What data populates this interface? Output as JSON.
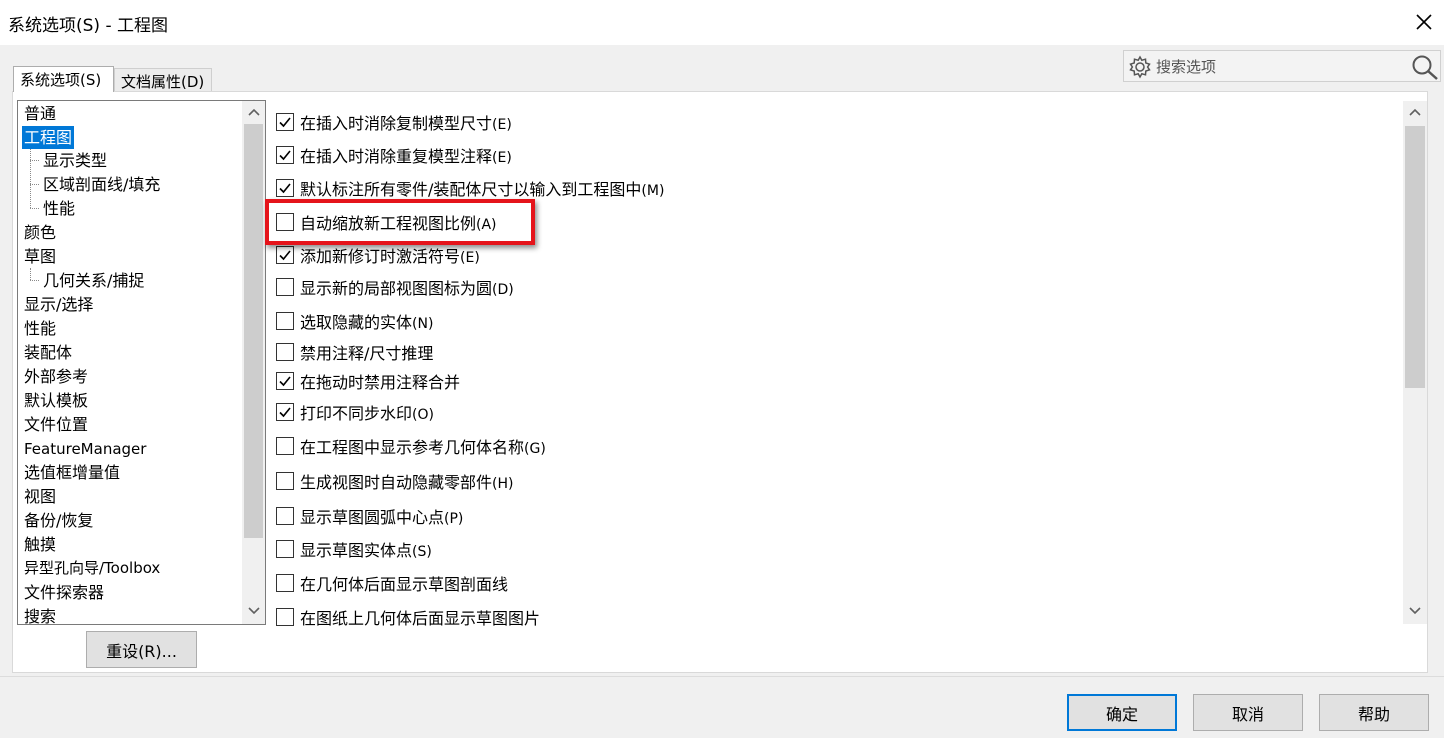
{
  "window": {
    "title": "系统选项(S) - 工程图",
    "close_icon": "close-icon"
  },
  "search": {
    "placeholder": "搜索选项",
    "gear_icon": "gear-icon",
    "search_icon": "search-icon"
  },
  "tabs": [
    {
      "label": "系统选项(S)",
      "active": true
    },
    {
      "label": "文档属性(D)",
      "active": false
    }
  ],
  "tree": {
    "items": [
      {
        "label": "普通",
        "level": 0,
        "selected": false
      },
      {
        "label": "工程图",
        "level": 0,
        "selected": true
      },
      {
        "label": "显示类型",
        "level": 1,
        "selected": false
      },
      {
        "label": "区域剖面线/填充",
        "level": 1,
        "selected": false
      },
      {
        "label": "性能",
        "level": 1,
        "selected": false
      },
      {
        "label": "颜色",
        "level": 0,
        "selected": false
      },
      {
        "label": "草图",
        "level": 0,
        "selected": false
      },
      {
        "label": "几何关系/捕捉",
        "level": 1,
        "selected": false
      },
      {
        "label": "显示/选择",
        "level": 0,
        "selected": false
      },
      {
        "label": "性能",
        "level": 0,
        "selected": false
      },
      {
        "label": "装配体",
        "level": 0,
        "selected": false
      },
      {
        "label": "外部参考",
        "level": 0,
        "selected": false
      },
      {
        "label": "默认模板",
        "level": 0,
        "selected": false
      },
      {
        "label": "文件位置",
        "level": 0,
        "selected": false
      },
      {
        "label": "FeatureManager",
        "level": 0,
        "selected": false
      },
      {
        "label": "选值框增量值",
        "level": 0,
        "selected": false
      },
      {
        "label": "视图",
        "level": 0,
        "selected": false
      },
      {
        "label": "备份/恢复",
        "level": 0,
        "selected": false
      },
      {
        "label": "触摸",
        "level": 0,
        "selected": false
      },
      {
        "label": "异型孔向导/Toolbox",
        "level": 0,
        "selected": false
      },
      {
        "label": "文件探索器",
        "level": 0,
        "selected": false
      },
      {
        "label": "搜索",
        "level": 0,
        "selected": false
      }
    ]
  },
  "reset_button": "重设(R)...",
  "options": [
    {
      "label": "在插入时消除复制模型尺寸",
      "key": "(E)",
      "checked": true
    },
    {
      "label": "在插入时消除重复模型注释",
      "key": "(E)",
      "checked": true
    },
    {
      "label": "默认标注所有零件/装配体尺寸以输入到工程图中",
      "key": "(M)",
      "checked": true
    },
    {
      "label": "自动缩放新工程视图比例",
      "key": "(A)",
      "checked": false
    },
    {
      "label": "添加新修订时激活符号",
      "key": "(E)",
      "checked": true
    },
    {
      "label": "显示新的局部视图图标为圆",
      "key": "(D)",
      "checked": false
    },
    {
      "label": "选取隐藏的实体",
      "key": "(N)",
      "checked": false
    },
    {
      "label": "禁用注释/尺寸推理",
      "key": "",
      "checked": false
    },
    {
      "label": "在拖动时禁用注释合并",
      "key": "",
      "checked": true
    },
    {
      "label": "打印不同步水印",
      "key": "(O)",
      "checked": true
    },
    {
      "label": "在工程图中显示参考几何体名称",
      "key": "(G)",
      "checked": false
    },
    {
      "label": "生成视图时自动隐藏零部件",
      "key": "(H)",
      "checked": false
    },
    {
      "label": "显示草图圆弧中心点",
      "key": "(P)",
      "checked": false
    },
    {
      "label": "显示草图实体点",
      "key": "(S)",
      "checked": false
    },
    {
      "label": "在几何体后面显示草图剖面线",
      "key": "",
      "checked": false
    },
    {
      "label": "在图纸上几何体后面显示草图图片",
      "key": "",
      "checked": false
    }
  ],
  "highlight_color": "#e5141b",
  "accent_color": "#0078d7",
  "buttons": {
    "ok": "确定",
    "cancel": "取消",
    "help": "帮助"
  }
}
